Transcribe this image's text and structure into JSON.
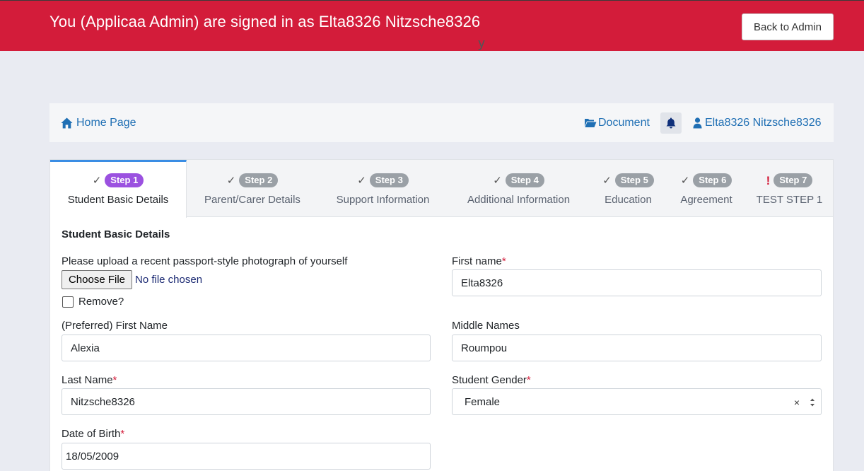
{
  "banner": {
    "message": "You (Applicaa Admin) are signed in as Elta8326 Nitzsche8326",
    "back_label": "Back to Admin",
    "peek_text": "y"
  },
  "nav": {
    "home_label": "Home Page",
    "document_label": "Document",
    "user_label": "Elta8326 Nitzsche8326"
  },
  "steps": [
    {
      "badge": "Step 1",
      "label": "Student Basic Details",
      "status": "check"
    },
    {
      "badge": "Step 2",
      "label": "Parent/Carer Details",
      "status": "check"
    },
    {
      "badge": "Step 3",
      "label": "Support Information",
      "status": "check"
    },
    {
      "badge": "Step 4",
      "label": "Additional Information",
      "status": "check"
    },
    {
      "badge": "Step 5",
      "label": "Education",
      "status": "check"
    },
    {
      "badge": "Step 6",
      "label": "Agreement",
      "status": "check"
    },
    {
      "badge": "Step 7",
      "label": "TEST STEP 1",
      "status": "!"
    }
  ],
  "form": {
    "section_title": "Student Basic Details",
    "photo_label": "Please upload a recent passport-style photograph of yourself",
    "file_button": "Choose File",
    "file_status": "No file chosen",
    "remove_label": "Remove?",
    "first_name_label": "First name",
    "first_name": "Elta8326",
    "preferred_label": "(Preferred) First Name",
    "preferred": "Alexia",
    "middle_label": "Middle Names",
    "middle": "Roumpou",
    "last_label": "Last Name",
    "last": "Nitzsche8326",
    "gender_label": "Student Gender",
    "gender": "Female",
    "clear_symbol": "×",
    "dob_label": "Date of Birth",
    "dob": "18/05/2009",
    "required_mark": "*"
  },
  "colors": {
    "banner": "#d31c3a",
    "link": "#1f6fb4",
    "active_badge": "#9b51e0",
    "badge": "#9aa0a6",
    "active_tab_border": "#3a8de4"
  }
}
